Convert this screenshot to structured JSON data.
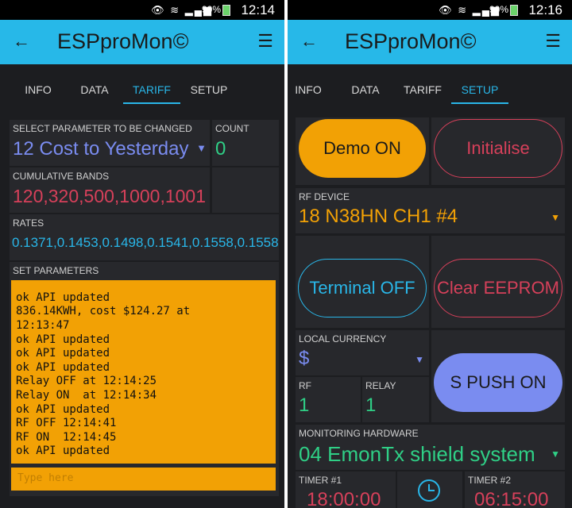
{
  "status": {
    "battery": "90%",
    "time_left": "12:14",
    "time_right": "12:16"
  },
  "app": {
    "title": "ESPproMon©",
    "back_icon": "arrow-left-icon",
    "menu_icon": "menu-icon"
  },
  "tabs": [
    {
      "label": "INFO"
    },
    {
      "label": "DATA"
    },
    {
      "label": "TARIFF"
    },
    {
      "label": "SETUP"
    }
  ],
  "left": {
    "active_tab": "TARIFF",
    "select_param": {
      "label": "SELECT PARAMETER TO BE CHANGED",
      "value": "12 Cost to Yesterday"
    },
    "count": {
      "label": "COUNT",
      "value": "0"
    },
    "bands": {
      "label": "CUMULATIVE BANDS",
      "value": "120,320,500,1000,1001"
    },
    "rates": {
      "label": "RATES",
      "value": "0.1371,0.1453,0.1498,0.1541,0.1558,0.1558"
    },
    "set_params": {
      "label": "SET PARAMETERS",
      "log": "ok API updated\n836.14KWH, cost $124.27 at\n12:13:47\nok API updated\nok API updated\nok API updated\nRelay OFF at 12:14:25\nRelay ON  at 12:14:34\nok API updated\nRF OFF 12:14:41\nRF ON  12:14:45\nok API updated",
      "partial_top": "ok API updated",
      "input_placeholder": "Type here"
    }
  },
  "right": {
    "active_tab": "SETUP",
    "demo_button": "Demo ON",
    "init_button": "Initialise",
    "rf_device": {
      "label": "RF DEVICE",
      "value": "18 N38HN CH1 #4"
    },
    "terminal_button": "Terminal OFF",
    "clear_button": "Clear EEPROM",
    "currency": {
      "label": "LOCAL CURRENCY",
      "value": "$"
    },
    "rf": {
      "label": "RF",
      "value": "1"
    },
    "relay": {
      "label": "RELAY",
      "value": "1"
    },
    "push_button": "S PUSH ON",
    "hardware": {
      "label": "MONITORING HARDWARE",
      "value": "04 EmonTx shield system"
    },
    "timer1": {
      "label": "TIMER #1",
      "value": "18:00:00"
    },
    "timer2": {
      "label": "TIMER #2",
      "value": "06:15:00"
    }
  },
  "colors": {
    "accent": "#27b8e8",
    "orange": "#f2a105",
    "red": "#d6405a",
    "green": "#2fcf86",
    "purple": "#7a8cf0",
    "blue": "#29b6e8"
  }
}
